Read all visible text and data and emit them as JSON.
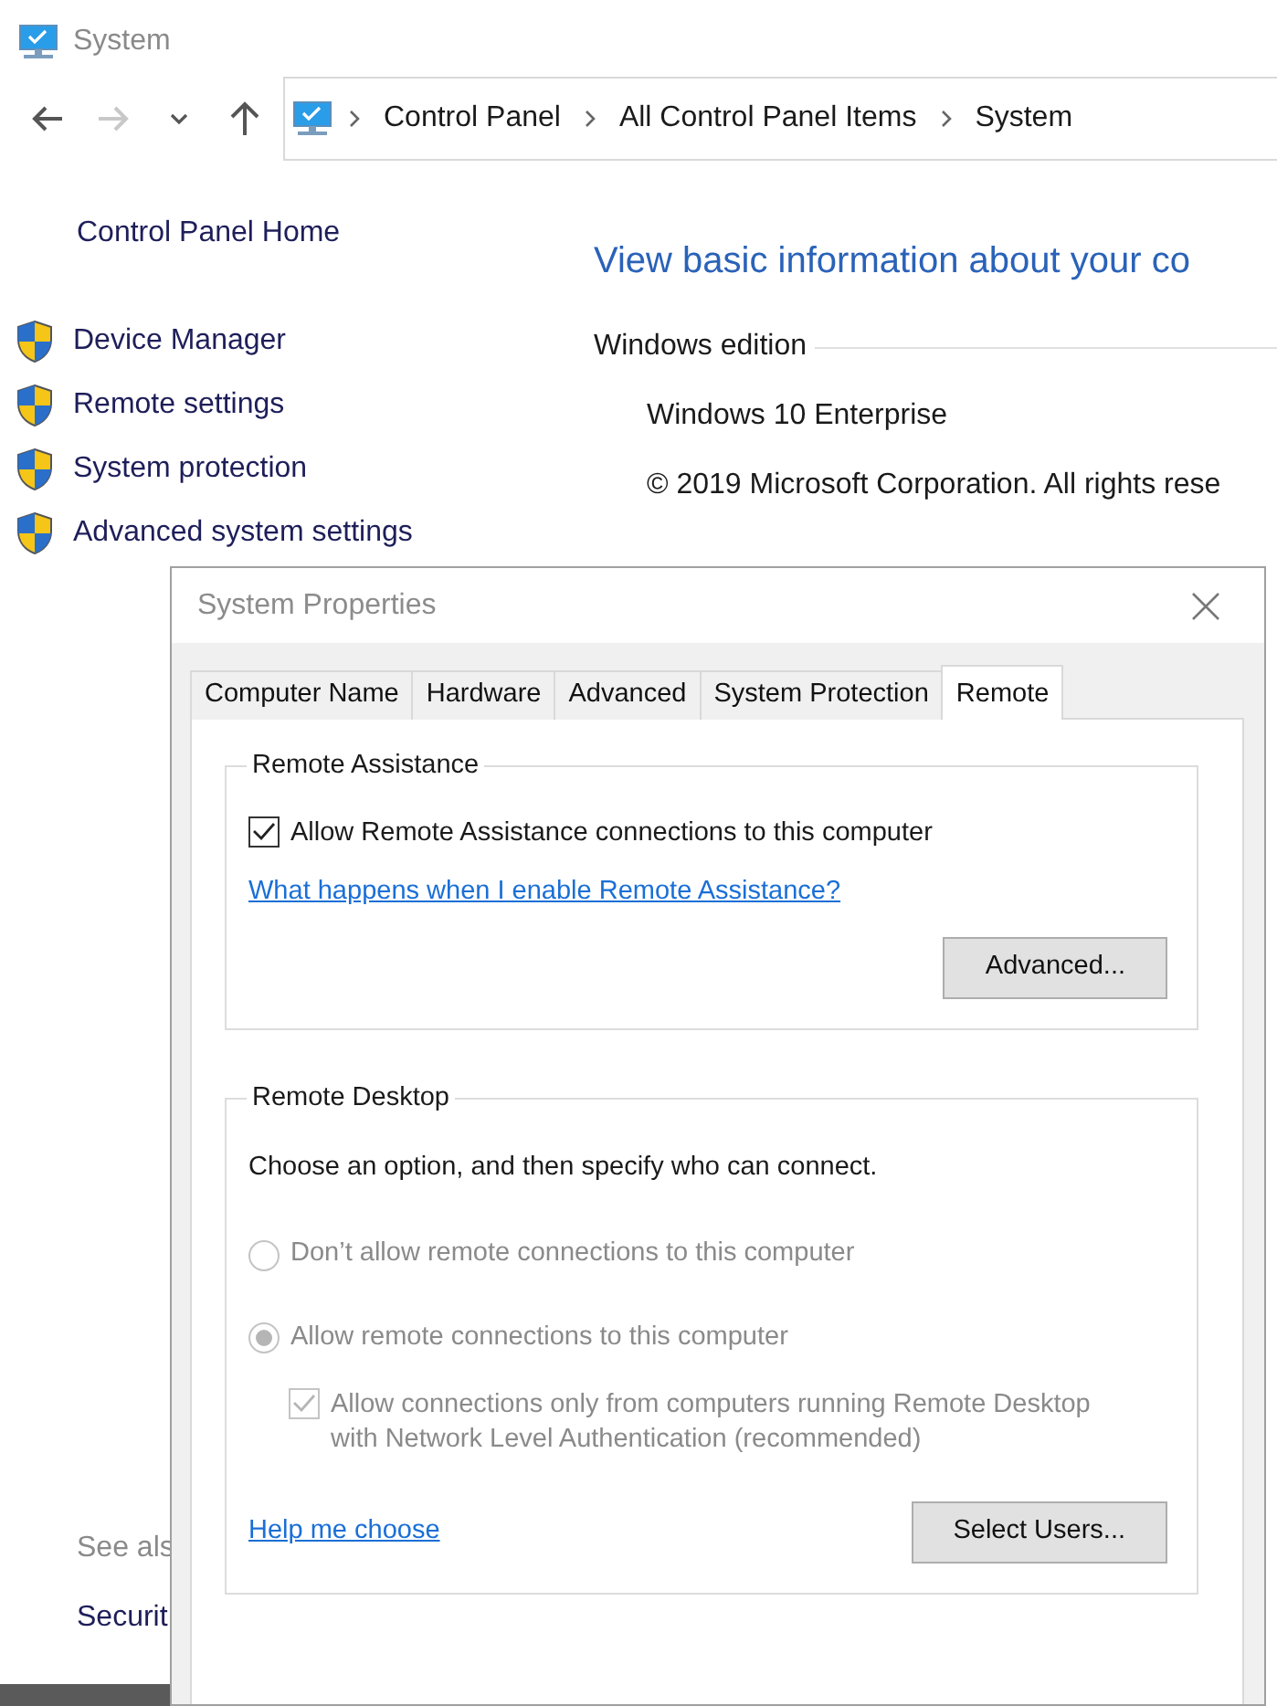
{
  "window": {
    "title": "System"
  },
  "nav_buttons": [
    {
      "kind": "back",
      "disabled": false
    },
    {
      "kind": "forward",
      "disabled": true
    },
    {
      "kind": "recent",
      "disabled": false
    },
    {
      "kind": "up",
      "disabled": false
    }
  ],
  "breadcrumb": [
    "Control Panel",
    "All Control Panel Items",
    "System"
  ],
  "sidebar": {
    "home": "Control Panel Home",
    "items": [
      {
        "label": "Device Manager"
      },
      {
        "label": "Remote settings"
      },
      {
        "label": "System protection"
      },
      {
        "label": "Advanced system settings"
      }
    ],
    "see_also": "See als",
    "see_also_items": [
      "Securit"
    ]
  },
  "main": {
    "heading": "View basic information about your co",
    "section": "Windows edition",
    "lines": [
      "Windows 10 Enterprise",
      "© 2019 Microsoft Corporation. All rights rese"
    ]
  },
  "dialog": {
    "title": "System Properties",
    "tabs": [
      {
        "label": "Computer Name",
        "selected": false
      },
      {
        "label": "Hardware",
        "selected": false
      },
      {
        "label": "Advanced",
        "selected": false
      },
      {
        "label": "System Protection",
        "selected": false
      },
      {
        "label": "Remote",
        "selected": true
      }
    ],
    "groups": [
      {
        "title": "Remote Assistance",
        "items": [
          {
            "kind": "checkbox",
            "label": "Allow Remote Assistance connections to this computer",
            "checked": true,
            "disabled": false
          },
          {
            "kind": "link",
            "label": "What happens when I enable Remote Assistance?"
          }
        ],
        "button": "Advanced..."
      },
      {
        "title": "Remote Desktop",
        "items": [
          {
            "kind": "text",
            "label": "Choose an option, and then specify who can connect."
          },
          {
            "kind": "radio",
            "label": "Don’t allow remote connections to this computer",
            "selected": false,
            "disabled": true
          },
          {
            "kind": "radio",
            "label": "Allow remote connections to this computer",
            "selected": true,
            "disabled": true,
            "children": [
              {
                "kind": "checkbox",
                "label": "Allow connections only from computers running Remote Desktop with Network Level Authentication (recommended)",
                "checked": true,
                "disabled": true
              }
            ]
          }
        ],
        "footer_link": "Help me choose",
        "button": "Select Users..."
      }
    ]
  }
}
